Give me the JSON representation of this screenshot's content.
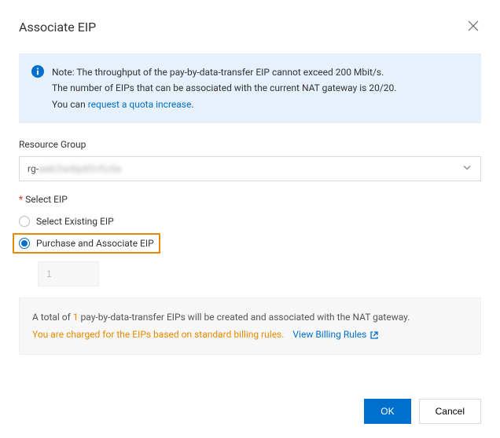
{
  "dialog": {
    "title": "Associate EIP"
  },
  "banner": {
    "line1": "Note: The throughput of the pay-by-data-transfer EIP cannot exceed 200 Mbit/s.",
    "line2": "The number of EIPs that can be associated with the current NAT gateway is 20/20.",
    "line3_prefix": "You can ",
    "line3_link": "request a quota increase",
    "line3_suffix": "."
  },
  "form": {
    "resource_group_label": "Resource Group",
    "resource_group_value_prefix": "rg-",
    "resource_group_value_blur": "aek2wdq4llvfu3a",
    "select_eip_label": "Select EIP",
    "radio_existing": "Select Existing EIP",
    "radio_purchase": "Purchase and Associate EIP",
    "quantity_value": "1"
  },
  "summary": {
    "prefix": "A total of ",
    "count": "1",
    "mid": " pay-by-data-transfer EIPs will be created and associated with the NAT gateway.",
    "warn": "You are charged for the EIPs based on standard billing rules.",
    "link": "View Billing Rules"
  },
  "footer": {
    "ok": "OK",
    "cancel": "Cancel"
  }
}
